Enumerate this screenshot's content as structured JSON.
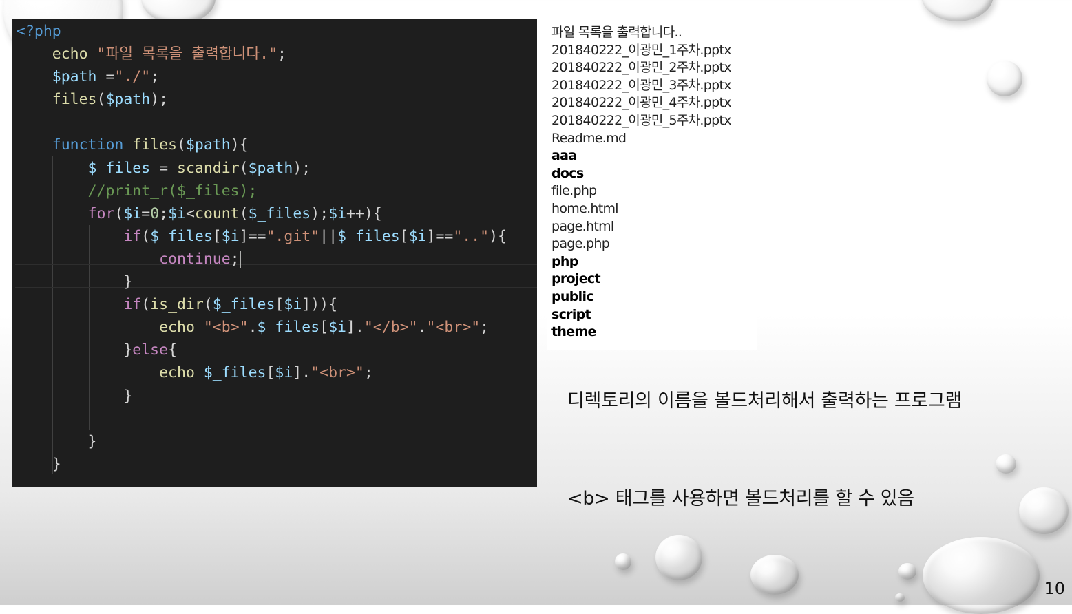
{
  "code_editor": {
    "lines": [
      [
        {
          "c": "php-tag",
          "t": "<?php"
        }
      ],
      [
        {
          "c": "pl",
          "t": "    "
        },
        {
          "c": "fn",
          "t": "echo"
        },
        {
          "c": "pl",
          "t": " "
        },
        {
          "c": "str",
          "t": "\"파일 목록을 출력합니다.\""
        },
        {
          "c": "pl",
          "t": ";"
        }
      ],
      [
        {
          "c": "pl",
          "t": "    "
        },
        {
          "c": "var",
          "t": "$path"
        },
        {
          "c": "pl",
          "t": " ="
        },
        {
          "c": "str",
          "t": "\"./\""
        },
        {
          "c": "pl",
          "t": ";"
        }
      ],
      [
        {
          "c": "pl",
          "t": "    "
        },
        {
          "c": "fn",
          "t": "files"
        },
        {
          "c": "pl",
          "t": "("
        },
        {
          "c": "var",
          "t": "$path"
        },
        {
          "c": "pl",
          "t": ");"
        }
      ],
      [
        {
          "c": "pl",
          "t": ""
        }
      ],
      [
        {
          "c": "pl",
          "t": "    "
        },
        {
          "c": "kw",
          "t": "function"
        },
        {
          "c": "pl",
          "t": " "
        },
        {
          "c": "fn",
          "t": "files"
        },
        {
          "c": "pl",
          "t": "("
        },
        {
          "c": "var",
          "t": "$path"
        },
        {
          "c": "pl",
          "t": "){"
        }
      ],
      [
        {
          "c": "pl",
          "t": "        "
        },
        {
          "c": "var",
          "t": "$_files"
        },
        {
          "c": "pl",
          "t": " = "
        },
        {
          "c": "fn",
          "t": "scandir"
        },
        {
          "c": "pl",
          "t": "("
        },
        {
          "c": "var",
          "t": "$path"
        },
        {
          "c": "pl",
          "t": ");"
        }
      ],
      [
        {
          "c": "pl",
          "t": "        "
        },
        {
          "c": "com",
          "t": "//print_r($_files);"
        }
      ],
      [
        {
          "c": "pl",
          "t": "        "
        },
        {
          "c": "kw-ctrl",
          "t": "for"
        },
        {
          "c": "pl",
          "t": "("
        },
        {
          "c": "var",
          "t": "$i"
        },
        {
          "c": "pl",
          "t": "="
        },
        {
          "c": "num",
          "t": "0"
        },
        {
          "c": "pl",
          "t": ";"
        },
        {
          "c": "var",
          "t": "$i"
        },
        {
          "c": "pl",
          "t": "<"
        },
        {
          "c": "fn",
          "t": "count"
        },
        {
          "c": "pl",
          "t": "("
        },
        {
          "c": "var",
          "t": "$_files"
        },
        {
          "c": "pl",
          "t": ");"
        },
        {
          "c": "var",
          "t": "$i"
        },
        {
          "c": "pl",
          "t": "++){"
        }
      ],
      [
        {
          "c": "pl",
          "t": "            "
        },
        {
          "c": "kw-ctrl",
          "t": "if"
        },
        {
          "c": "pl",
          "t": "("
        },
        {
          "c": "var",
          "t": "$_files"
        },
        {
          "c": "pl",
          "t": "["
        },
        {
          "c": "var",
          "t": "$i"
        },
        {
          "c": "pl",
          "t": "]=="
        },
        {
          "c": "str",
          "t": "\".git\""
        },
        {
          "c": "pl",
          "t": "||"
        },
        {
          "c": "var",
          "t": "$_files"
        },
        {
          "c": "pl",
          "t": "["
        },
        {
          "c": "var",
          "t": "$i"
        },
        {
          "c": "pl",
          "t": "]=="
        },
        {
          "c": "str",
          "t": "\"..\""
        },
        {
          "c": "pl",
          "t": "){"
        }
      ],
      [
        {
          "c": "pl",
          "t": "                "
        },
        {
          "c": "kw-ctrl",
          "t": "continue"
        },
        {
          "c": "pl",
          "t": ";"
        },
        {
          "c": "caret",
          "t": ""
        }
      ],
      [
        {
          "c": "pl",
          "t": "            }"
        }
      ],
      [
        {
          "c": "pl",
          "t": "            "
        },
        {
          "c": "kw-ctrl",
          "t": "if"
        },
        {
          "c": "pl",
          "t": "("
        },
        {
          "c": "fn",
          "t": "is_dir"
        },
        {
          "c": "pl",
          "t": "("
        },
        {
          "c": "var",
          "t": "$_files"
        },
        {
          "c": "pl",
          "t": "["
        },
        {
          "c": "var",
          "t": "$i"
        },
        {
          "c": "pl",
          "t": "])){"
        }
      ],
      [
        {
          "c": "pl",
          "t": "                "
        },
        {
          "c": "fn",
          "t": "echo"
        },
        {
          "c": "pl",
          "t": " "
        },
        {
          "c": "str",
          "t": "\"<b>\""
        },
        {
          "c": "pl",
          "t": "."
        },
        {
          "c": "var",
          "t": "$_files"
        },
        {
          "c": "pl",
          "t": "["
        },
        {
          "c": "var",
          "t": "$i"
        },
        {
          "c": "pl",
          "t": "]."
        },
        {
          "c": "str",
          "t": "\"</b>\""
        },
        {
          "c": "pl",
          "t": "."
        },
        {
          "c": "str",
          "t": "\"<br>\""
        },
        {
          "c": "pl",
          "t": ";"
        }
      ],
      [
        {
          "c": "pl",
          "t": "            }"
        },
        {
          "c": "kw-ctrl",
          "t": "else"
        },
        {
          "c": "pl",
          "t": "{"
        }
      ],
      [
        {
          "c": "pl",
          "t": "                "
        },
        {
          "c": "fn",
          "t": "echo"
        },
        {
          "c": "pl",
          "t": " "
        },
        {
          "c": "var",
          "t": "$_files"
        },
        {
          "c": "pl",
          "t": "["
        },
        {
          "c": "var",
          "t": "$i"
        },
        {
          "c": "pl",
          "t": "]."
        },
        {
          "c": "str",
          "t": "\"<br>\""
        },
        {
          "c": "pl",
          "t": ";"
        }
      ],
      [
        {
          "c": "pl",
          "t": "            }"
        }
      ],
      [
        {
          "c": "pl",
          "t": ""
        }
      ],
      [
        {
          "c": "pl",
          "t": "        }"
        }
      ],
      [
        {
          "c": "pl",
          "t": "    }"
        }
      ]
    ]
  },
  "output": {
    "lines": [
      {
        "text": "파일 목록을 출력합니다..",
        "bold": false
      },
      {
        "text": "201840222_이광민_1주차.pptx",
        "bold": false
      },
      {
        "text": "201840222_이광민_2주차.pptx",
        "bold": false
      },
      {
        "text": "201840222_이광민_3주차.pptx",
        "bold": false
      },
      {
        "text": "201840222_이광민_4주차.pptx",
        "bold": false
      },
      {
        "text": "201840222_이광민_5주차.pptx",
        "bold": false
      },
      {
        "text": "Readme.md",
        "bold": false
      },
      {
        "text": "aaa",
        "bold": true
      },
      {
        "text": "docs",
        "bold": true
      },
      {
        "text": "file.php",
        "bold": false
      },
      {
        "text": "home.html",
        "bold": false
      },
      {
        "text": "page.html",
        "bold": false
      },
      {
        "text": "page.php",
        "bold": false
      },
      {
        "text": "php",
        "bold": true
      },
      {
        "text": "project",
        "bold": true
      },
      {
        "text": "public",
        "bold": true
      },
      {
        "text": "script",
        "bold": true
      },
      {
        "text": "theme",
        "bold": true
      }
    ]
  },
  "slide": {
    "description": "디렉토리의 이름을 볼드처리해서 출력하는 프로그램",
    "tip": "<b> 태그를 사용하면 볼드처리를 할 수 있음",
    "page_number": "10"
  }
}
